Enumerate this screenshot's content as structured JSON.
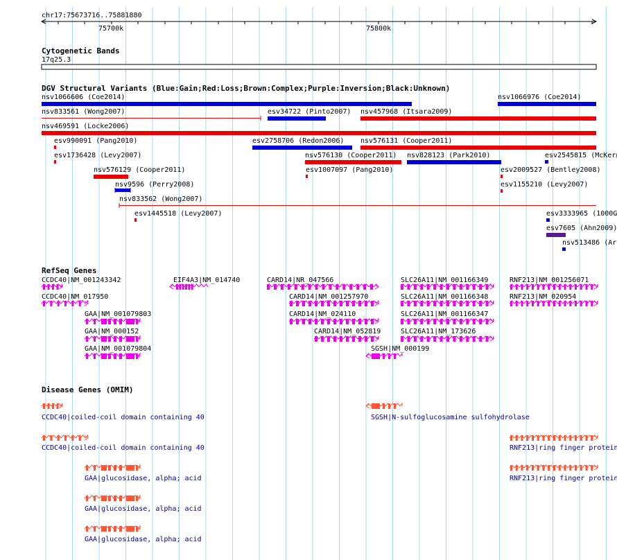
{
  "ruler": {
    "region": "chr17:75673716..75881880",
    "ticks": [
      "75700k",
      "75800k"
    ]
  },
  "cytobands": {
    "title": "Cytogenetic Bands",
    "band": "17q25.3"
  },
  "dgv": {
    "title": "DGV Structural Variants (Blue:Gain;Red:Loss;Brown:Complex;Purple:Inversion;Black:Unknown)",
    "colors": {
      "gain": "#0000dd",
      "loss": "#ee0000",
      "inversion": "#5a1a8c"
    },
    "variants": [
      {
        "label": "nsv1066606 (Coe2014)",
        "type": "gain"
      },
      {
        "label": "nsv1066976 (Coe2014)",
        "type": "gain"
      },
      {
        "label": "nsv833561 (Wong2007)",
        "type": "loss"
      },
      {
        "label": "esv34722 (Pinto2007)",
        "type": "gain"
      },
      {
        "label": "nsv457968 (Itsara2009)",
        "type": "loss"
      },
      {
        "label": "nsv469591 (Locke2006)",
        "type": "loss"
      },
      {
        "label": "esv990091 (Pang2010)",
        "type": "loss"
      },
      {
        "label": "esv2758706 (Redon2006)",
        "type": "gain"
      },
      {
        "label": "nsv576131 (Cooper2011)",
        "type": "loss"
      },
      {
        "label": "esv1736428 (Levy2007)",
        "type": "loss"
      },
      {
        "label": "nsv576130 (Cooper2011)",
        "type": "loss"
      },
      {
        "label": "nsv828123 (Park2010)",
        "type": "gain"
      },
      {
        "label": "esv2545815 (McKern",
        "type": "gain"
      },
      {
        "label": "nsv576129 (Cooper2011)",
        "type": "loss"
      },
      {
        "label": "esv1007097 (Pang2010)",
        "type": "loss"
      },
      {
        "label": "esv2009527 (Bentley2008)",
        "type": "loss"
      },
      {
        "label": "nsv9596 (Perry2008)",
        "type": "gain"
      },
      {
        "label": "esv1155210 (Levy2007)",
        "type": "loss"
      },
      {
        "label": "nsv833562 (Wong2007)",
        "type": "loss"
      },
      {
        "label": "esv1445518 (Levy2007)",
        "type": "loss"
      },
      {
        "label": "esv3333965 (1000G",
        "type": "gain"
      },
      {
        "label": "esv7605 (Ahn2009)",
        "type": "inversion"
      },
      {
        "label": "nsv513486 (Ar",
        "type": "gain"
      }
    ]
  },
  "refseq": {
    "title": "RefSeq Genes",
    "color": "#ee00ee",
    "genes": [
      "CCDC40|NM_001243342",
      "CCDC40|NM_017950",
      "GAA|NM_001079803",
      "GAA|NM_000152",
      "GAA|NM_001079804",
      "EIF4A3|NM_014740",
      "CARD14|NR_047566",
      "CARD14|NM_001257970",
      "CARD14|NM_024110",
      "CARD14|NM_052819",
      "SGSH|NM_000199",
      "SLC26A11|NM_001166349",
      "SLC26A11|NM_001166348",
      "SLC26A11|NM_001166347",
      "SLC26A11|NM_173626",
      "RNF213|NM_001256071",
      "RNF213|NM_020954"
    ]
  },
  "omim": {
    "title": "Disease Genes (OMIM)",
    "color": "#ff5533",
    "label_color": "#000088",
    "genes": [
      "CCDC40|coiled-coil domain containing 40",
      "CCDC40|coiled-coil domain containing 40",
      "GAA|glucosidase, alpha; acid",
      "GAA|glucosidase, alpha; acid",
      "GAA|glucosidase, alpha; acid",
      "SGSH|N-sulfoglucosamine sulfohydrolase",
      "RNF213|ring finger protein",
      "RNF213|ring finger protein"
    ]
  }
}
